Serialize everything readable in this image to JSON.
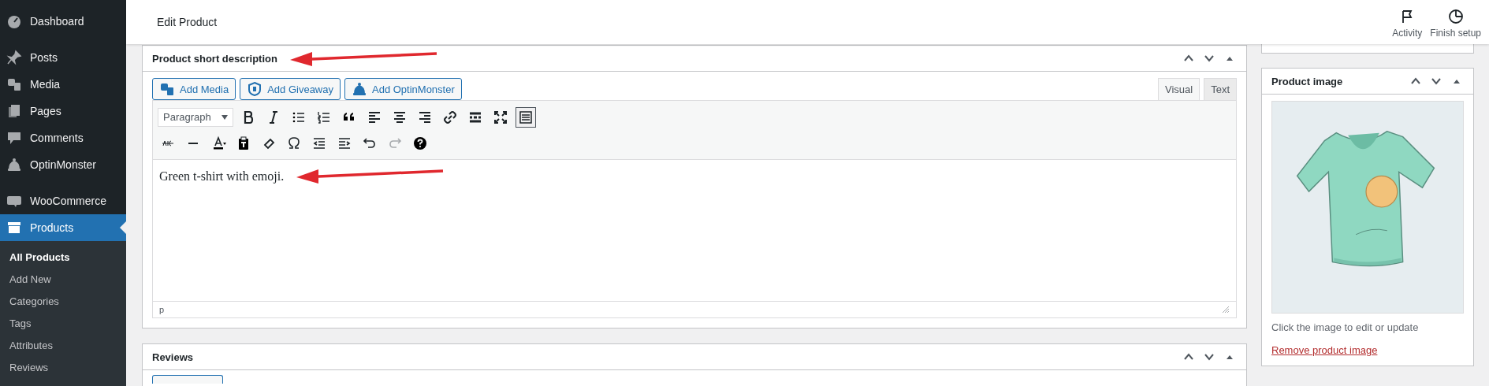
{
  "sidebar": {
    "items": [
      {
        "label": "Dashboard",
        "selected": false
      },
      {
        "label": "Posts",
        "selected": false
      },
      {
        "label": "Media",
        "selected": false
      },
      {
        "label": "Pages",
        "selected": false
      },
      {
        "label": "Comments",
        "selected": false
      },
      {
        "label": "OptinMonster",
        "selected": false
      },
      {
        "label": "WooCommerce",
        "selected": false
      },
      {
        "label": "Products",
        "selected": true
      }
    ],
    "submenu": [
      {
        "label": "All Products",
        "selected": true
      },
      {
        "label": "Add New",
        "selected": false
      },
      {
        "label": "Categories",
        "selected": false
      },
      {
        "label": "Tags",
        "selected": false
      },
      {
        "label": "Attributes",
        "selected": false
      },
      {
        "label": "Reviews",
        "selected": false
      }
    ]
  },
  "top_bar": {
    "title": "Edit Product",
    "actions": [
      {
        "label": "Activity"
      },
      {
        "label": "Finish setup"
      }
    ]
  },
  "short_description": {
    "title": "Product short description",
    "annotated": true,
    "media_buttons": [
      {
        "label": "Add Media"
      },
      {
        "label": "Add Giveaway"
      },
      {
        "label": "Add OptinMonster"
      }
    ],
    "tabs": [
      {
        "label": "Visual",
        "selected": true
      },
      {
        "label": "Text",
        "selected": false
      }
    ],
    "format": "Paragraph",
    "toolbar_toggle_on": true,
    "redo_disabled": true,
    "content": "Green t-shirt with emoji.",
    "content_annotated": true,
    "path": "p"
  },
  "reviews": {
    "title": "Reviews"
  },
  "product_image": {
    "title": "Product image",
    "caption": "Click the image to edit or update",
    "link": "Remove product image"
  }
}
